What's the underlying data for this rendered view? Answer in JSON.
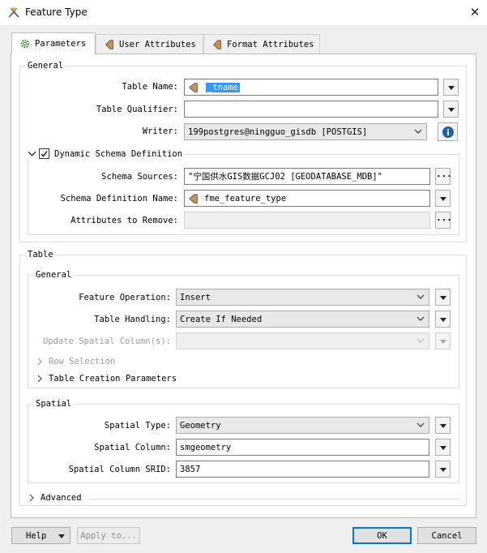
{
  "window": {
    "title": "Feature Type"
  },
  "tabs": [
    {
      "label": "Parameters",
      "icon": "gear-icon",
      "active": true
    },
    {
      "label": "User Attributes",
      "icon": "attribute-icon",
      "active": false
    },
    {
      "label": "Format Attributes",
      "icon": "attribute-icon",
      "active": false
    }
  ],
  "general": {
    "title": "General",
    "table_name_label": "Table Name:",
    "table_name_value": "_tname",
    "table_qualifier_label": "Table Qualifier:",
    "table_qualifier_value": "",
    "writer_label": "Writer:",
    "writer_value": "199postgres@ningguo_gisdb [POSTGIS]"
  },
  "dynamic_schema": {
    "title": "Dynamic Schema Definition",
    "checked": true,
    "schema_sources_label": "Schema Sources:",
    "schema_sources_value": "\"宁国供水GIS数据GCJ02 [GEODATABASE_MDB]\"",
    "schema_definition_name_label": "Schema Definition Name:",
    "schema_definition_name_value": "fme_feature_type",
    "attributes_to_remove_label": "Attributes to Remove:",
    "attributes_to_remove_value": ""
  },
  "table": {
    "title": "Table",
    "general_title": "General",
    "feature_operation_label": "Feature Operation:",
    "feature_operation_value": "Insert",
    "table_handling_label": "Table Handling:",
    "table_handling_value": "Create If Needed",
    "update_spatial_label": "Update Spatial Column(s):",
    "update_spatial_value": "",
    "row_selection_label": "Row Selection",
    "table_creation_label": "Table Creation Parameters"
  },
  "spatial": {
    "title": "Spatial",
    "spatial_type_label": "Spatial Type:",
    "spatial_type_value": "Geometry",
    "spatial_column_label": "Spatial Column:",
    "spatial_column_value": "smgeometry",
    "srid_label": "Spatial Column SRID:",
    "srid_value": "3857"
  },
  "advanced_label": "Advanced",
  "buttons": {
    "help": "Help",
    "apply_to": "Apply to...",
    "ok": "OK",
    "cancel": "Cancel"
  },
  "colors": {
    "accent": "#0078d7",
    "selection": "#3399ff",
    "attr_icon": "#c8935a"
  }
}
